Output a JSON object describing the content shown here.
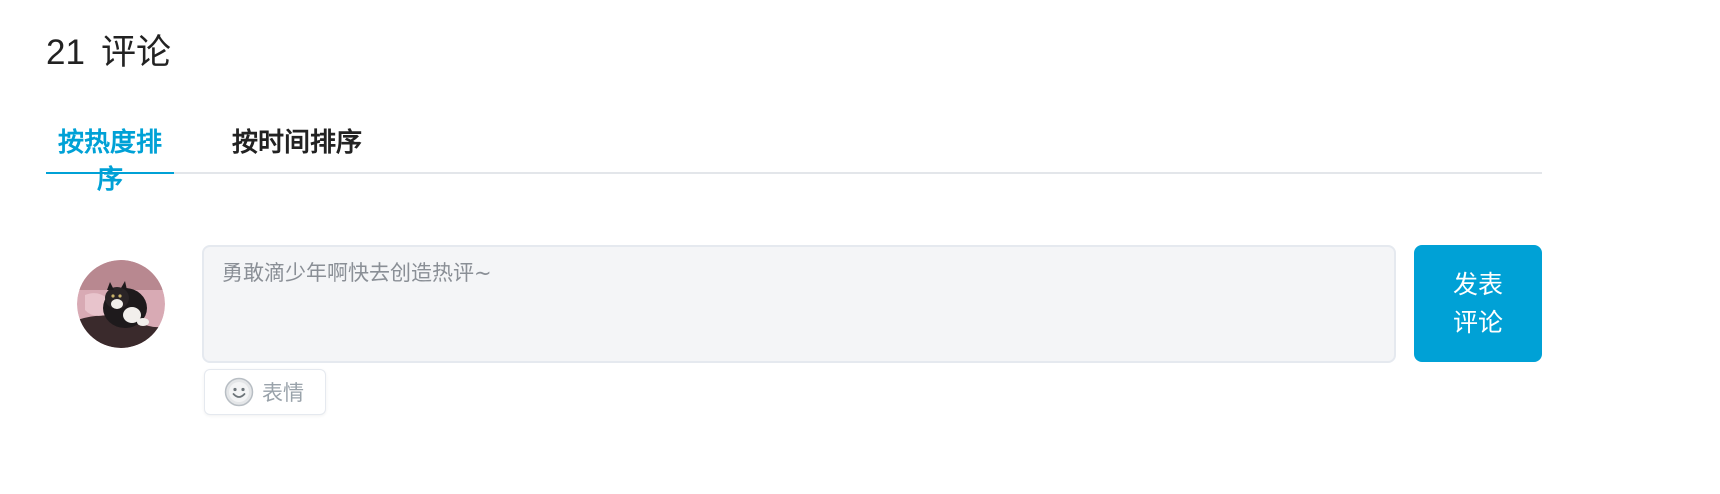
{
  "header": {
    "count": "21",
    "label": "评论"
  },
  "tabs": [
    {
      "label": "按热度排序",
      "active": true
    },
    {
      "label": "按时间排序",
      "active": false
    }
  ],
  "composer": {
    "placeholder": "勇敢滴少年啊快去创造热评~",
    "submit_line1": "发表",
    "submit_line2": "评论",
    "emoji_label": "表情"
  },
  "colors": {
    "accent": "#00a1d6",
    "input_bg": "#f4f5f7",
    "muted_text": "#99a2aa"
  },
  "icons": {
    "emoji": "smiley-face-icon",
    "avatar": "user-avatar-cat"
  }
}
